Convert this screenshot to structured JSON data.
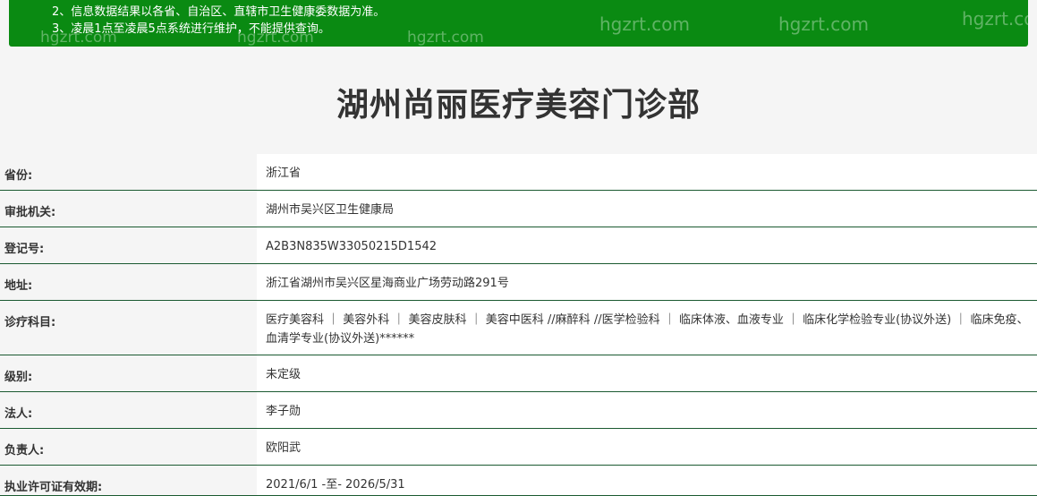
{
  "notice": {
    "line1": "2、信息数据结果以各省、自治区、直辖市卫生健康委数据为准。",
    "line2": "3、凌晨1点至凌晨5点系统进行维护，不能提供查询。",
    "watermark": "hgzrt.com"
  },
  "page_title": "湖州尚丽医疗美容门诊部",
  "rows": [
    {
      "label": "省份:",
      "value": "浙江省"
    },
    {
      "label": "审批机关:",
      "value": "湖州市吴兴区卫生健康局"
    },
    {
      "label": "登记号:",
      "value": "A2B3N835W33050215D1542"
    },
    {
      "label": "地址:",
      "value": "浙江省湖州市吴兴区星海商业广场劳动路291号"
    },
    {
      "label": "诊疗科目:",
      "value": "医疗美容科 ｜ 美容外科 ｜ 美容皮肤科 ｜ 美容中医科 //麻醉科 //医学检验科 ｜ 临床体液、血液专业 ｜ 临床化学检验专业(协议外送) ｜ 临床免疫、血清学专业(协议外送)******"
    },
    {
      "label": "级别:",
      "value": "未定级"
    },
    {
      "label": "法人:",
      "value": "李子勋"
    },
    {
      "label": "负责人:",
      "value": "欧阳武"
    },
    {
      "label": "执业许可证有效期:",
      "value": "2021/6/1 -至- 2026/5/31"
    }
  ]
}
